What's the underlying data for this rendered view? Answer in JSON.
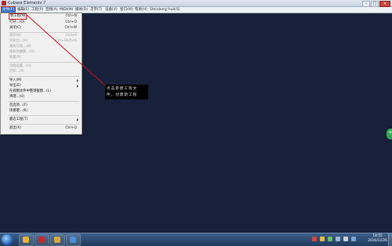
{
  "window": {
    "title": "Cubase Elements 7"
  },
  "menubar": {
    "items": [
      {
        "label": "文件(F)",
        "active": true
      },
      {
        "label": "编辑(E)"
      },
      {
        "label": "工程(P)"
      },
      {
        "label": "音频(A)"
      },
      {
        "label": "MIDI(M)"
      },
      {
        "label": "媒体(D)"
      },
      {
        "label": "走带(T)"
      },
      {
        "label": "设备(V)"
      },
      {
        "label": "窗口(W)"
      },
      {
        "label": "帮助(H)"
      },
      {
        "label": "Steinberg Hub(S)"
      }
    ]
  },
  "file_menu": {
    "items": [
      {
        "label": "新工程(N)",
        "shortcut": "Ctrl+N",
        "highlight": true
      },
      {
        "label": "打开...(O)",
        "shortcut": "Ctrl+O"
      },
      {
        "label": "关闭(C)",
        "shortcut": "Ctrl+W"
      },
      {
        "label": "保存(S)",
        "shortcut": "Ctrl+S",
        "disabled": true
      },
      {
        "label": "另存为...(A)",
        "shortcut": "Ctrl+Shift+S",
        "disabled": true
      },
      {
        "label": "备份工程...(B)",
        "disabled": true
      },
      {
        "label": "保存为模板...(V)",
        "disabled": true
      },
      {
        "label": "恢复(R)",
        "disabled": true
      },
      {
        "label": "页面设置...(U)",
        "disabled": true
      },
      {
        "label": "打印...(P)",
        "disabled": true
      },
      {
        "label": "导入(M)",
        "submenu": true
      },
      {
        "label": "导出(E)",
        "submenu": true
      },
      {
        "label": "在视图文件中整理截图...(L)"
      },
      {
        "label": "清理...(U)"
      },
      {
        "label": "首选项...(F)"
      },
      {
        "label": "快捷键...(K)"
      },
      {
        "label": "最近工程(T)",
        "submenu": true
      },
      {
        "label": "退出(X)",
        "shortcut": "Ctrl+Q"
      }
    ]
  },
  "annotation": {
    "line1": "点击新建工程文",
    "line2": "件，创建新工程"
  },
  "taskbar": {
    "clock_time": "18:55",
    "clock_date": "2016/12/26"
  },
  "colors": {
    "workspace": "#17213a",
    "annotation_line": "#c0141c",
    "menu_highlight": "#d2232a"
  }
}
